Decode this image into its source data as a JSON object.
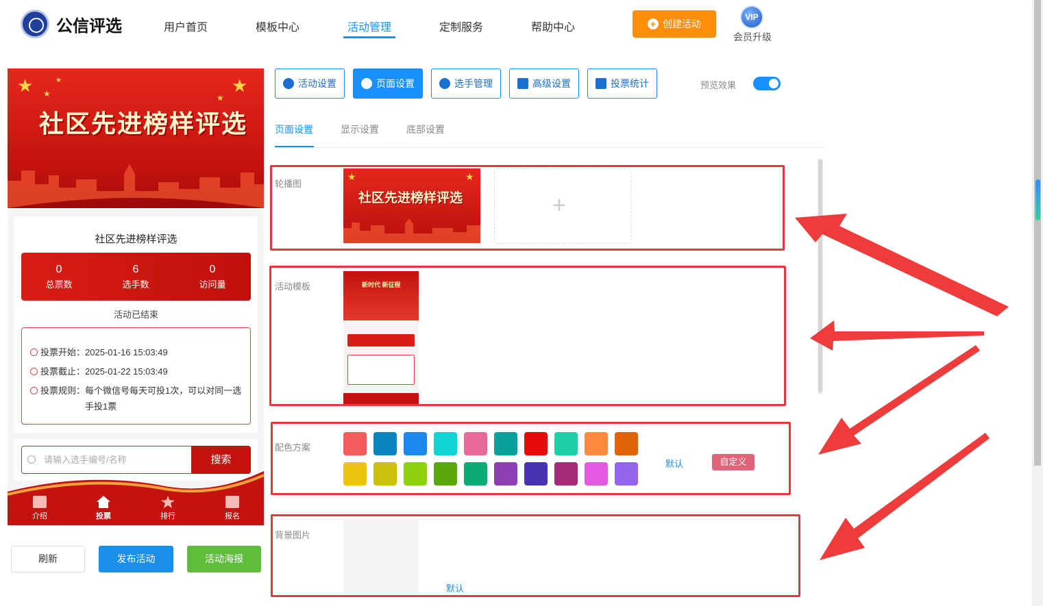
{
  "header": {
    "brand": "公信评选",
    "nav": [
      "用户首页",
      "模板中心",
      "活动管理",
      "定制服务",
      "帮助中心"
    ],
    "active_nav": "活动管理",
    "create_button": "创建活动",
    "vip_badge": "VIP",
    "vip_label": "会员升级"
  },
  "preview": {
    "banner_title": "社区先进榜样评选",
    "activity_title": "社区先进榜样评选",
    "stats": [
      {
        "value": "0",
        "label": "总票数"
      },
      {
        "value": "6",
        "label": "选手数"
      },
      {
        "value": "0",
        "label": "访问量"
      }
    ],
    "status": "活动已结束",
    "vote_start": "投票开始：2025-01-16 15:03:49",
    "vote_end": "投票截止：2025-01-22 15:03:49",
    "vote_rule_line1": "投票规则：每个微信号每天可投1次，可以对同一选",
    "vote_rule_line2": "手投1票",
    "search_placeholder": "请输入选手编号/名称",
    "search_button": "搜索",
    "bottom_tabs": [
      "介绍",
      "投票",
      "排行",
      "报名"
    ]
  },
  "actions": {
    "refresh": "刷新",
    "publish": "发布活动",
    "poster": "活动海报"
  },
  "settings": {
    "top_tabs": [
      "活动设置",
      "页面设置",
      "选手管理",
      "高级设置",
      "投票统计"
    ],
    "active_top_tab": "页面设置",
    "preview_label": "预览效果",
    "preview_on": true,
    "sub_tabs": [
      "页面设置",
      "显示设置",
      "底部设置"
    ],
    "active_sub_tab": "页面设置",
    "carousel_label": "轮播图",
    "carousel_image_title": "社区先进榜样评选",
    "template_label": "活动模板",
    "template_image_title": "新时代 新征程",
    "color_label": "配色方案",
    "color_default": "默认",
    "color_custom": "自定义",
    "bg_label": "背景图片",
    "bg_default": "默认"
  },
  "colors": {
    "row1": [
      "#f45b5b",
      "#0a84c0",
      "#1c87ee",
      "#11d4d4",
      "#e86a98",
      "#0aa09a",
      "#e60b0b",
      "#1dd0a5",
      "#ff8a3d",
      "#e06205"
    ],
    "row2": [
      "#ecc410",
      "#c9c10a",
      "#8ed10f",
      "#5aa70b",
      "#0caa74",
      "#8b3fb1",
      "#4a33b0",
      "#a52a78",
      "#e35be0",
      "#9466f0"
    ]
  }
}
